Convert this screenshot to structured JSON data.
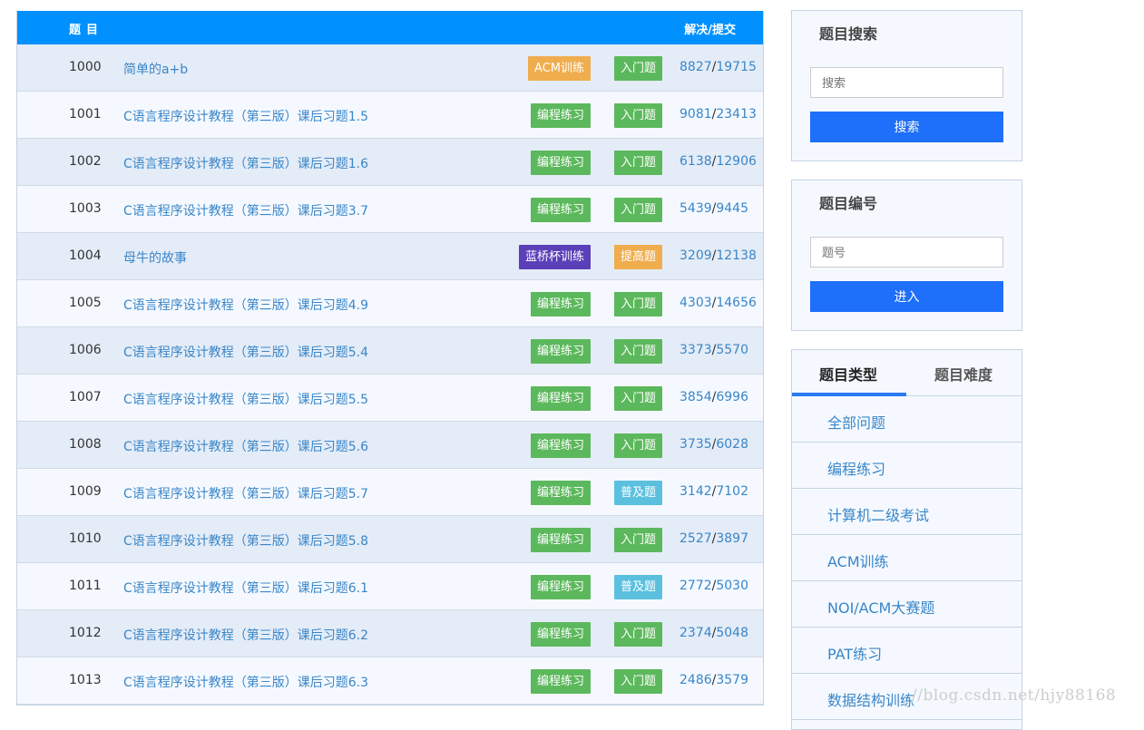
{
  "table": {
    "header_title": "题目",
    "header_ratio": "解决/提交",
    "rows": [
      {
        "id": "1000",
        "title": "简单的a+b",
        "category": "ACM训练",
        "category_color": "#f0ad4e",
        "level": "入门题",
        "level_color": "#5cb85c",
        "solved": "8827",
        "submitted": "19715"
      },
      {
        "id": "1001",
        "title": "C语言程序设计教程（第三版）课后习题1.5",
        "category": "编程练习",
        "category_color": "#5cb85c",
        "level": "入门题",
        "level_color": "#5cb85c",
        "solved": "9081",
        "submitted": "23413"
      },
      {
        "id": "1002",
        "title": "C语言程序设计教程（第三版）课后习题1.6",
        "category": "编程练习",
        "category_color": "#5cb85c",
        "level": "入门题",
        "level_color": "#5cb85c",
        "solved": "6138",
        "submitted": "12906"
      },
      {
        "id": "1003",
        "title": "C语言程序设计教程（第三版）课后习题3.7",
        "category": "编程练习",
        "category_color": "#5cb85c",
        "level": "入门题",
        "level_color": "#5cb85c",
        "solved": "5439",
        "submitted": "9445"
      },
      {
        "id": "1004",
        "title": "母牛的故事",
        "category": "蓝桥杯训练",
        "category_color": "#5b3fb8",
        "level": "提高题",
        "level_color": "#f0ad4e",
        "solved": "3209",
        "submitted": "12138"
      },
      {
        "id": "1005",
        "title": "C语言程序设计教程（第三版）课后习题4.9",
        "category": "编程练习",
        "category_color": "#5cb85c",
        "level": "入门题",
        "level_color": "#5cb85c",
        "solved": "4303",
        "submitted": "14656"
      },
      {
        "id": "1006",
        "title": "C语言程序设计教程（第三版）课后习题5.4",
        "category": "编程练习",
        "category_color": "#5cb85c",
        "level": "入门题",
        "level_color": "#5cb85c",
        "solved": "3373",
        "submitted": "5570"
      },
      {
        "id": "1007",
        "title": "C语言程序设计教程（第三版）课后习题5.5",
        "category": "编程练习",
        "category_color": "#5cb85c",
        "level": "入门题",
        "level_color": "#5cb85c",
        "solved": "3854",
        "submitted": "6996"
      },
      {
        "id": "1008",
        "title": "C语言程序设计教程（第三版）课后习题5.6",
        "category": "编程练习",
        "category_color": "#5cb85c",
        "level": "入门题",
        "level_color": "#5cb85c",
        "solved": "3735",
        "submitted": "6028"
      },
      {
        "id": "1009",
        "title": "C语言程序设计教程（第三版）课后习题5.7",
        "category": "编程练习",
        "category_color": "#5cb85c",
        "level": "普及题",
        "level_color": "#5bc0de",
        "solved": "3142",
        "submitted": "7102"
      },
      {
        "id": "1010",
        "title": "C语言程序设计教程（第三版）课后习题5.8",
        "category": "编程练习",
        "category_color": "#5cb85c",
        "level": "入门题",
        "level_color": "#5cb85c",
        "solved": "2527",
        "submitted": "3897"
      },
      {
        "id": "1011",
        "title": "C语言程序设计教程（第三版）课后习题6.1",
        "category": "编程练习",
        "category_color": "#5cb85c",
        "level": "普及题",
        "level_color": "#5bc0de",
        "solved": "2772",
        "submitted": "5030"
      },
      {
        "id": "1012",
        "title": "C语言程序设计教程（第三版）课后习题6.2",
        "category": "编程练习",
        "category_color": "#5cb85c",
        "level": "入门题",
        "level_color": "#5cb85c",
        "solved": "2374",
        "submitted": "5048"
      },
      {
        "id": "1013",
        "title": "C语言程序设计教程（第三版）课后习题6.3",
        "category": "编程练习",
        "category_color": "#5cb85c",
        "level": "入门题",
        "level_color": "#5cb85c",
        "solved": "2486",
        "submitted": "3579"
      }
    ]
  },
  "search": {
    "title": "题目搜索",
    "placeholder": "搜索",
    "button": "搜索"
  },
  "number": {
    "title": "题目编号",
    "placeholder": "题号",
    "button": "进入"
  },
  "types": {
    "tabs": [
      "题目类型",
      "题目难度"
    ],
    "items": [
      "全部问题",
      "编程练习",
      "计算机二级考试",
      "ACM训练",
      "NOI/ACM大赛题",
      "PAT练习",
      "数据结构训练"
    ]
  },
  "watermark": "//blog.csdn.net/hjy88168"
}
